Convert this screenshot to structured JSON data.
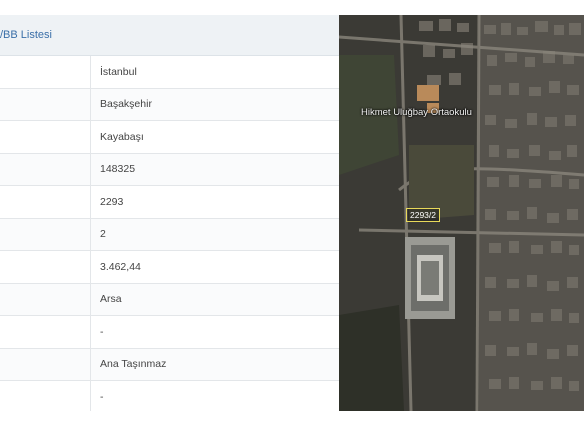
{
  "header": {
    "title": "/BB Listesi"
  },
  "rows": [
    {
      "value": "İstanbul"
    },
    {
      "value": "Başakşehir"
    },
    {
      "value": "Kayabaşı"
    },
    {
      "value": "148325"
    },
    {
      "value": "2293"
    },
    {
      "value": "2"
    },
    {
      "value": "3.462,44"
    },
    {
      "value": "Arsa"
    },
    {
      "value": "-"
    },
    {
      "value": "Ana Taşınmaz"
    },
    {
      "value": "-"
    }
  ],
  "map": {
    "school_label": "Hikmet Uluğbay Ortaokulu",
    "parcel_label": "2293/2"
  },
  "colors": {
    "header_bg": "#eef2f5",
    "header_text": "#3a6fa8",
    "parcel_outline": "#e8d95a"
  }
}
